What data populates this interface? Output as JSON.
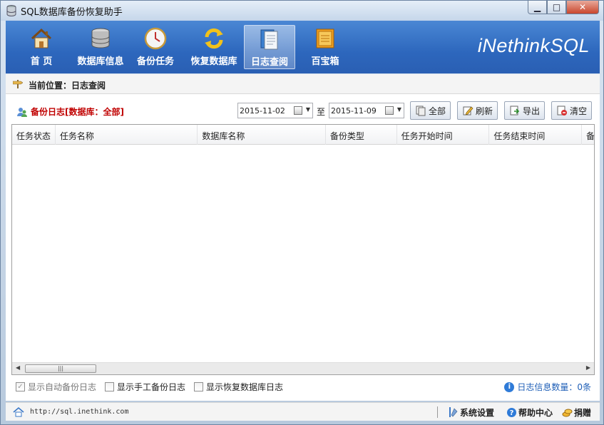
{
  "window": {
    "title": "SQL数据库备份恢复助手"
  },
  "toolbar": {
    "items": [
      {
        "label": "首 页",
        "icon": "home-icon"
      },
      {
        "label": "数据库信息",
        "icon": "database-icon"
      },
      {
        "label": "备份任务",
        "icon": "clock-icon"
      },
      {
        "label": "恢复数据库",
        "icon": "refresh-icon"
      },
      {
        "label": "日志查阅",
        "icon": "log-book-icon",
        "active": true
      },
      {
        "label": "百宝箱",
        "icon": "treasure-box-icon"
      }
    ],
    "brand": "iNethinkSQL"
  },
  "breadcrumb": {
    "label": "当前位置：日志查阅"
  },
  "log": {
    "title": "备份日志[数据库：全部]",
    "date_from": "2015-11-02",
    "to_label": "至",
    "date_to": "2015-11-09",
    "buttons": {
      "all": "全部",
      "refresh": "刷新",
      "export": "导出",
      "clear": "清空"
    }
  },
  "table": {
    "columns": [
      "任务状态",
      "任务名称",
      "数据库名称",
      "备份类型",
      "任务开始时间",
      "任务结束时间",
      "备"
    ],
    "rows": []
  },
  "filters": {
    "auto": "显示自动备份日志",
    "manual": "显示手工备份日志",
    "restore": "显示恢复数据库日志"
  },
  "count": {
    "label": "日志信息数量：0条"
  },
  "status": {
    "url": "http://sql.inethink.com",
    "settings": "系统设置",
    "help": "帮助中心",
    "donate": "捐赠"
  },
  "colors": {
    "accent": "#2d67bd",
    "title_red": "#c00000",
    "link_blue": "#1f5fb7"
  }
}
